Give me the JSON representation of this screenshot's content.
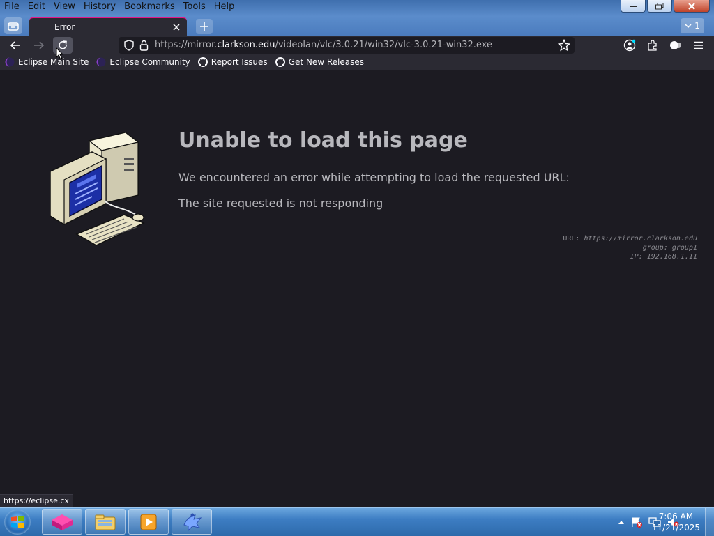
{
  "menu": [
    "File",
    "Edit",
    "View",
    "History",
    "Bookmarks",
    "Tools",
    "Help"
  ],
  "tab": {
    "title": "Error",
    "overflow_count": "1"
  },
  "url": {
    "prefix": "https://mirror.",
    "host": "clarkson.edu",
    "path": "/videolan/vlc/3.0.21/win32/vlc-3.0.21-win32.exe"
  },
  "bookmarks": [
    {
      "label": "Eclipse Main Site",
      "icon": "eclipse-icon"
    },
    {
      "label": "Eclipse Community",
      "icon": "eclipse-icon"
    },
    {
      "label": "Report Issues",
      "icon": "github-icon"
    },
    {
      "label": "Get New Releases",
      "icon": "github-icon"
    }
  ],
  "error": {
    "title": "Unable to load this page",
    "description": "We encountered an error while attempting to load the requested URL:",
    "reason": "The site requested is not responding",
    "meta": {
      "url_key": "URL:",
      "url_val": "https://mirror.clarkson.edu",
      "group_key": "group:",
      "group_val": "group1",
      "ip_key": "IP:",
      "ip_val": "192.168.1.11"
    }
  },
  "status_text": "https://eclipse.cx",
  "clock": {
    "time": "7:06 AM",
    "date": "11/21/2025"
  },
  "colors": {
    "content_bg": "#1c1b22",
    "toolbar_bg": "#2b2a33",
    "tab_accent": "#e31587"
  }
}
